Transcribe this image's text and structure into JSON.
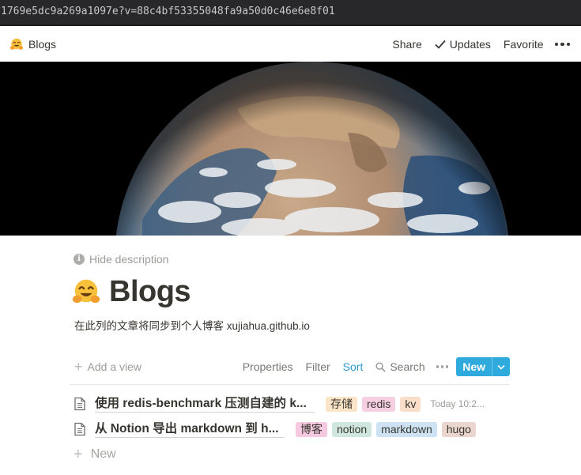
{
  "browser": {
    "url": "1769e5dc9a269a1097e?v=88c4bf53355048fa9a50d0c46e6e8f01"
  },
  "topbar": {
    "breadcrumb_icon": "hugging-face-emoji",
    "breadcrumb": "Blogs",
    "share": "Share",
    "updates": "Updates",
    "favorite": "Favorite"
  },
  "cover": {
    "image": "earth-from-space"
  },
  "page": {
    "hide_description": "Hide description",
    "icon": "hugging-face-emoji",
    "title": "Blogs",
    "description": "在此列的文章将同步到个人博客 xujiahua.github.io"
  },
  "toolbar": {
    "add_view": "Add a view",
    "properties": "Properties",
    "filter": "Filter",
    "sort": "Sort",
    "search": "Search",
    "new": "New"
  },
  "rows": [
    {
      "title": "使用 redis-benchmark 压测自建的 k...",
      "tags": [
        {
          "label": "存储",
          "color": "#fbe4c7"
        },
        {
          "label": "redis",
          "color": "#f6cfe3"
        },
        {
          "label": "kv",
          "color": "#fadec9"
        }
      ],
      "date": "Today 10:2..."
    },
    {
      "title": "从 Notion 导出 markdown 到 h...",
      "tags": [
        {
          "label": "博客",
          "color": "#f5c9df"
        },
        {
          "label": "notion",
          "color": "#cfe7df"
        },
        {
          "label": "markdown",
          "color": "#cde3f3"
        },
        {
          "label": "hugo",
          "color": "#ead6cf"
        }
      ],
      "date": ""
    }
  ],
  "new_row": "New",
  "colors": {
    "accent": "#2eaadc",
    "sort": "#2e9ad6",
    "text": "#37352f",
    "muted": "#9b9a97"
  }
}
